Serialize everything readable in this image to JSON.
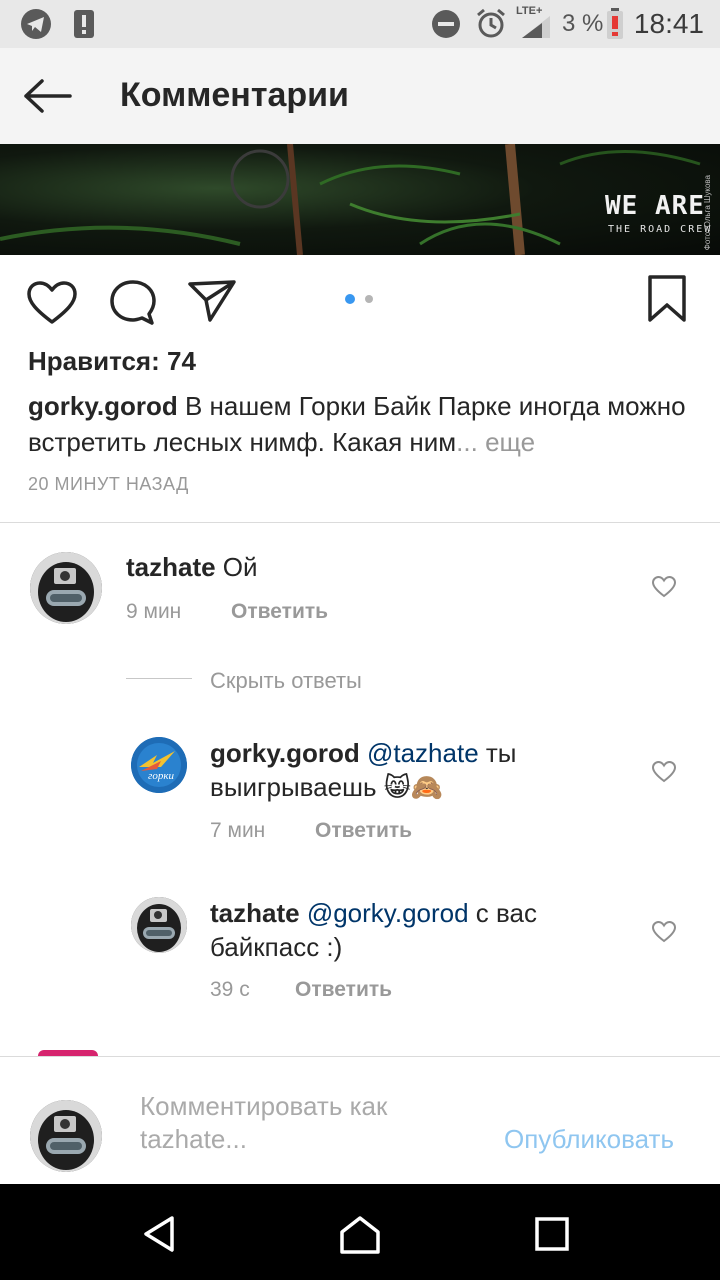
{
  "status_bar": {
    "time": "18:41",
    "battery_percent": "3 %",
    "network": "LTE+",
    "icons": [
      "telegram-icon",
      "alert-icon",
      "do-not-disturb-icon",
      "alarm-icon",
      "signal-icon",
      "battery-low-icon"
    ]
  },
  "header": {
    "title": "Комментарии",
    "back_icon": "back-arrow-icon"
  },
  "banner": {
    "logo_text": "WE ARE",
    "logo_subtext": "THE ROAD CREW",
    "photo_credit": "Фото: Ольга Шукова"
  },
  "actions": {
    "icons": [
      "heart-icon",
      "comment-icon",
      "share-icon",
      "bookmark-icon"
    ],
    "carousel_active_color": "#3897f0",
    "carousel_dots": 2,
    "carousel_active_index": 0
  },
  "post": {
    "likes": "Нравится: 74",
    "author": "gorky.gorod",
    "caption_text": " В нашем Горки Байк Парке иногда можно встретить лесных нимф. Какая ним",
    "caption_ellipsis": "...",
    "more_label": " еще",
    "time_ago": "20 МИНУТ НАЗАД"
  },
  "comments": [
    {
      "user": "tazhate",
      "text": " Ой",
      "time": "9 мин",
      "reply_label": "Ответить"
    }
  ],
  "hide_replies_label": "Скрыть ответы",
  "replies": [
    {
      "user": "gorky.gorod",
      "mention": "@tazhate",
      "text": " ты выигрываешь 😸🙈",
      "time": "7 мин",
      "reply_label": "Ответить",
      "avatar_text": "горки"
    },
    {
      "user": "tazhate",
      "mention": "@gorky.gorod",
      "text": " с вас байкпасс :)",
      "time": "39 с",
      "reply_label": "Ответить"
    }
  ],
  "composer": {
    "placeholder": "Комментировать как tazhate...",
    "publish_label": "Опубликовать"
  },
  "colors": {
    "link": "#003569",
    "publish_disabled": "#8fc6f0",
    "muted": "#999999"
  }
}
